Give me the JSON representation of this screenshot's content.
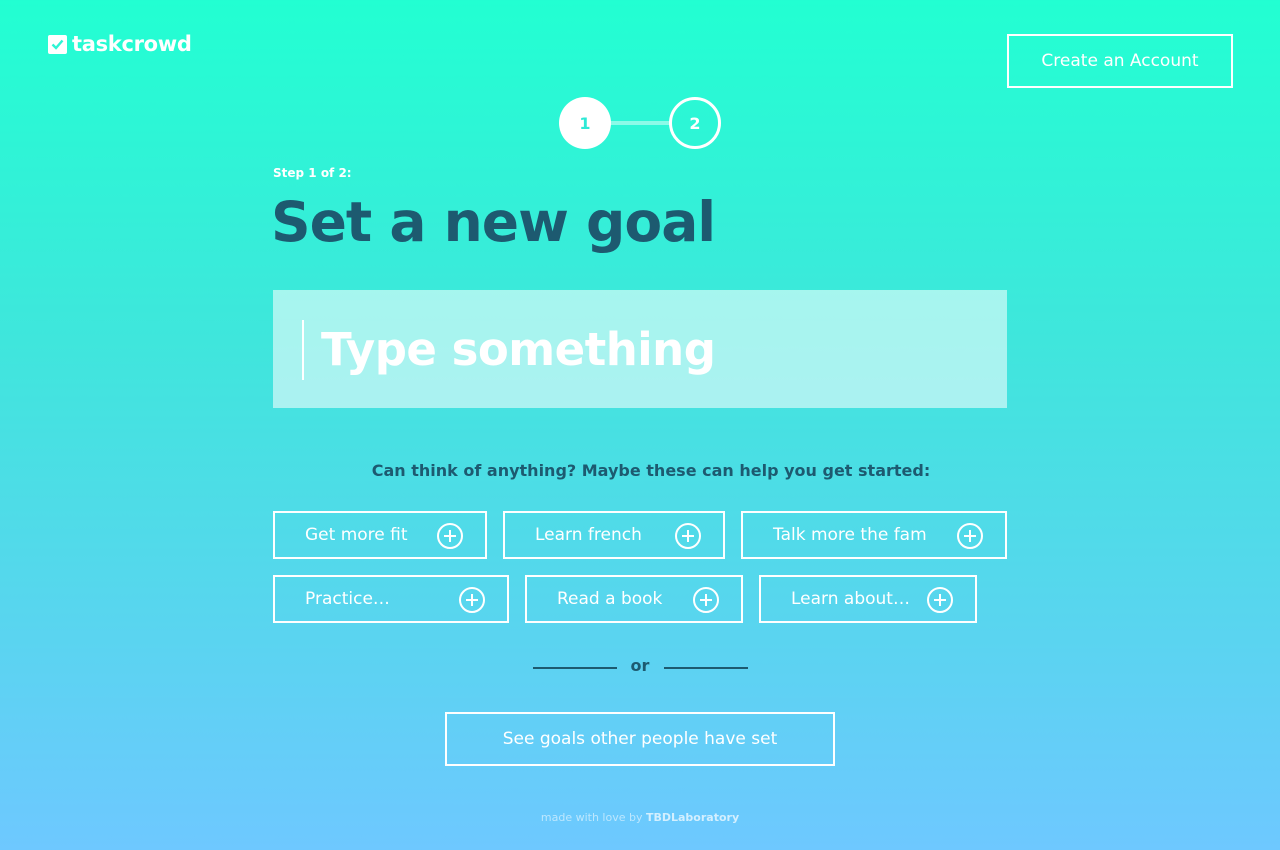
{
  "brand": {
    "name": "taskcrowd",
    "icon": "check-icon"
  },
  "header": {
    "create_account_label": "Create an Account"
  },
  "stepper": {
    "steps": [
      "1",
      "2"
    ],
    "current": 1,
    "label": "Step 1 of 2:"
  },
  "main": {
    "title": "Set a new goal",
    "goal_input": {
      "placeholder": "Type something",
      "value": ""
    },
    "helper_text": "Can think of anything? Maybe these can help you get started:",
    "suggestions": [
      "Get more fit",
      "Learn french",
      "Talk more the fam",
      "Practice…",
      "Read a book",
      "Learn about…"
    ],
    "or_text": "or",
    "see_goals_label": "See goals other people have set"
  },
  "footer": {
    "text": "made with love by",
    "credit": "TBDLaboratory"
  },
  "colors": {
    "gradient_top": "#22ffd2",
    "gradient_bottom": "#6ec8ff",
    "dark_text": "#1d5a70",
    "white": "#ffffff"
  }
}
